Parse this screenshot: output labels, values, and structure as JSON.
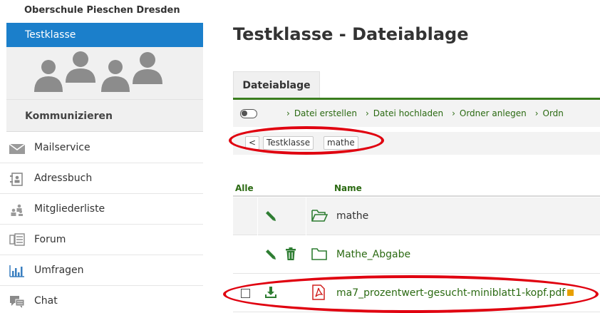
{
  "sidebar": {
    "school_name": "Oberschule Pieschen Dresden",
    "group_name": "Testklasse",
    "section_title": "Kommunizieren",
    "items": [
      {
        "label": "Mailservice",
        "icon": "envelope-icon"
      },
      {
        "label": "Adressbuch",
        "icon": "address-book-icon"
      },
      {
        "label": "Mitgliederliste",
        "icon": "members-icon"
      },
      {
        "label": "Forum",
        "icon": "forum-icon"
      },
      {
        "label": "Umfragen",
        "icon": "poll-chart-icon"
      },
      {
        "label": "Chat",
        "icon": "chat-icon"
      }
    ]
  },
  "main": {
    "title": "Testklasse - Dateiablage",
    "tab": "Dateiablage",
    "toolbar": {
      "actions": [
        "Datei erstellen",
        "Datei hochladen",
        "Ordner anlegen",
        "Ordn"
      ]
    },
    "breadcrumb": {
      "back": "<",
      "items": [
        "Testklasse",
        "mathe"
      ]
    },
    "table": {
      "headers": {
        "all": "Alle",
        "name": "Name"
      },
      "rows": [
        {
          "name": "mathe",
          "type": "folder-open",
          "current": true
        },
        {
          "name": "Mathe_Abgabe",
          "type": "folder"
        },
        {
          "name": "ma7_prozentwert-gesucht-miniblatt1-kopf.pdf",
          "type": "pdf"
        }
      ]
    }
  },
  "colors": {
    "accent_blue": "#1b7fcb",
    "accent_green": "#2b6a12",
    "highlight_red": "#e0000f",
    "pdf_red": "#d0201e"
  }
}
